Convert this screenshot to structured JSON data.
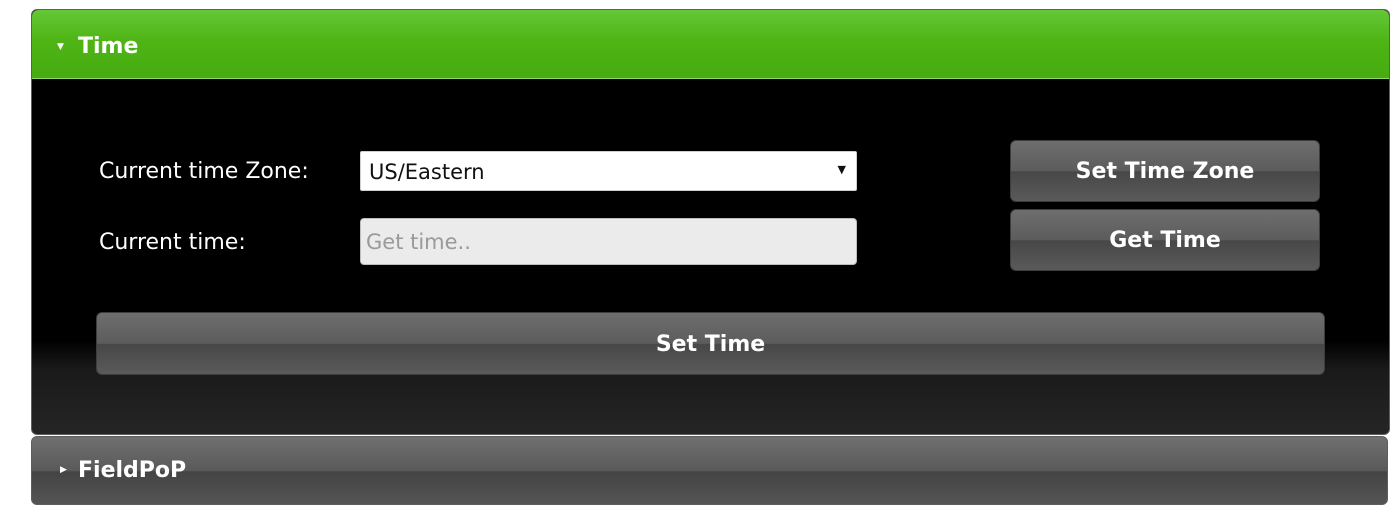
{
  "time_panel": {
    "title": "Time",
    "expanded": true,
    "header_color": "#4fb515",
    "fields": {
      "zone_label": "Current time Zone:",
      "zone_selected": "US/Eastern",
      "time_label": "Current time:",
      "time_value": "",
      "time_placeholder": "Get time.."
    },
    "buttons": {
      "set_time_zone": "Set Time Zone",
      "get_time": "Get Time",
      "set_time": "Set Time"
    }
  },
  "fieldpop_panel": {
    "title": "FieldPoP",
    "expanded": false
  },
  "icons": {
    "expanded": "caret-down-icon",
    "collapsed": "caret-right-icon",
    "dropdown": "dropdown-arrow-icon"
  }
}
